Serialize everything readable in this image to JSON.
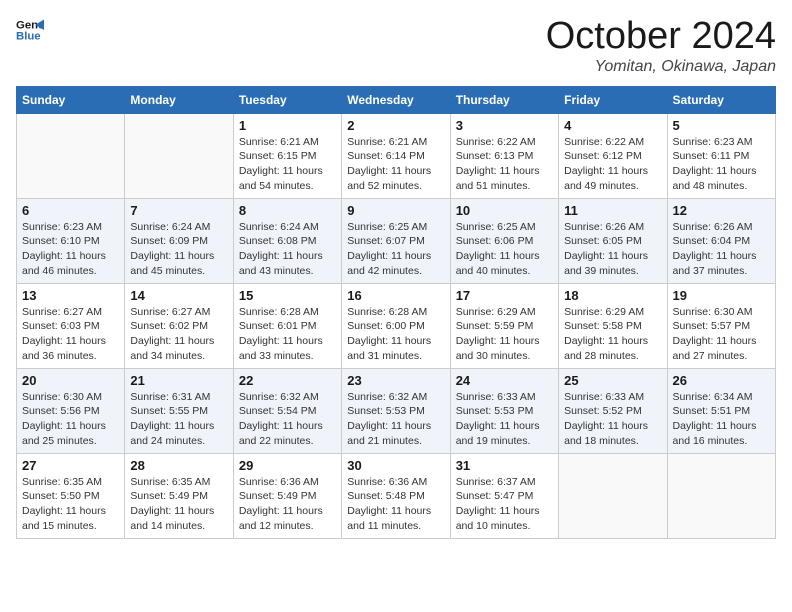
{
  "header": {
    "logo_line1": "General",
    "logo_line2": "Blue",
    "month": "October 2024",
    "location": "Yomitan, Okinawa, Japan"
  },
  "weekdays": [
    "Sunday",
    "Monday",
    "Tuesday",
    "Wednesday",
    "Thursday",
    "Friday",
    "Saturday"
  ],
  "weeks": [
    [
      {
        "day": "",
        "info": ""
      },
      {
        "day": "",
        "info": ""
      },
      {
        "day": "1",
        "info": "Sunrise: 6:21 AM\nSunset: 6:15 PM\nDaylight: 11 hours and 54 minutes."
      },
      {
        "day": "2",
        "info": "Sunrise: 6:21 AM\nSunset: 6:14 PM\nDaylight: 11 hours and 52 minutes."
      },
      {
        "day": "3",
        "info": "Sunrise: 6:22 AM\nSunset: 6:13 PM\nDaylight: 11 hours and 51 minutes."
      },
      {
        "day": "4",
        "info": "Sunrise: 6:22 AM\nSunset: 6:12 PM\nDaylight: 11 hours and 49 minutes."
      },
      {
        "day": "5",
        "info": "Sunrise: 6:23 AM\nSunset: 6:11 PM\nDaylight: 11 hours and 48 minutes."
      }
    ],
    [
      {
        "day": "6",
        "info": "Sunrise: 6:23 AM\nSunset: 6:10 PM\nDaylight: 11 hours and 46 minutes."
      },
      {
        "day": "7",
        "info": "Sunrise: 6:24 AM\nSunset: 6:09 PM\nDaylight: 11 hours and 45 minutes."
      },
      {
        "day": "8",
        "info": "Sunrise: 6:24 AM\nSunset: 6:08 PM\nDaylight: 11 hours and 43 minutes."
      },
      {
        "day": "9",
        "info": "Sunrise: 6:25 AM\nSunset: 6:07 PM\nDaylight: 11 hours and 42 minutes."
      },
      {
        "day": "10",
        "info": "Sunrise: 6:25 AM\nSunset: 6:06 PM\nDaylight: 11 hours and 40 minutes."
      },
      {
        "day": "11",
        "info": "Sunrise: 6:26 AM\nSunset: 6:05 PM\nDaylight: 11 hours and 39 minutes."
      },
      {
        "day": "12",
        "info": "Sunrise: 6:26 AM\nSunset: 6:04 PM\nDaylight: 11 hours and 37 minutes."
      }
    ],
    [
      {
        "day": "13",
        "info": "Sunrise: 6:27 AM\nSunset: 6:03 PM\nDaylight: 11 hours and 36 minutes."
      },
      {
        "day": "14",
        "info": "Sunrise: 6:27 AM\nSunset: 6:02 PM\nDaylight: 11 hours and 34 minutes."
      },
      {
        "day": "15",
        "info": "Sunrise: 6:28 AM\nSunset: 6:01 PM\nDaylight: 11 hours and 33 minutes."
      },
      {
        "day": "16",
        "info": "Sunrise: 6:28 AM\nSunset: 6:00 PM\nDaylight: 11 hours and 31 minutes."
      },
      {
        "day": "17",
        "info": "Sunrise: 6:29 AM\nSunset: 5:59 PM\nDaylight: 11 hours and 30 minutes."
      },
      {
        "day": "18",
        "info": "Sunrise: 6:29 AM\nSunset: 5:58 PM\nDaylight: 11 hours and 28 minutes."
      },
      {
        "day": "19",
        "info": "Sunrise: 6:30 AM\nSunset: 5:57 PM\nDaylight: 11 hours and 27 minutes."
      }
    ],
    [
      {
        "day": "20",
        "info": "Sunrise: 6:30 AM\nSunset: 5:56 PM\nDaylight: 11 hours and 25 minutes."
      },
      {
        "day": "21",
        "info": "Sunrise: 6:31 AM\nSunset: 5:55 PM\nDaylight: 11 hours and 24 minutes."
      },
      {
        "day": "22",
        "info": "Sunrise: 6:32 AM\nSunset: 5:54 PM\nDaylight: 11 hours and 22 minutes."
      },
      {
        "day": "23",
        "info": "Sunrise: 6:32 AM\nSunset: 5:53 PM\nDaylight: 11 hours and 21 minutes."
      },
      {
        "day": "24",
        "info": "Sunrise: 6:33 AM\nSunset: 5:53 PM\nDaylight: 11 hours and 19 minutes."
      },
      {
        "day": "25",
        "info": "Sunrise: 6:33 AM\nSunset: 5:52 PM\nDaylight: 11 hours and 18 minutes."
      },
      {
        "day": "26",
        "info": "Sunrise: 6:34 AM\nSunset: 5:51 PM\nDaylight: 11 hours and 16 minutes."
      }
    ],
    [
      {
        "day": "27",
        "info": "Sunrise: 6:35 AM\nSunset: 5:50 PM\nDaylight: 11 hours and 15 minutes."
      },
      {
        "day": "28",
        "info": "Sunrise: 6:35 AM\nSunset: 5:49 PM\nDaylight: 11 hours and 14 minutes."
      },
      {
        "day": "29",
        "info": "Sunrise: 6:36 AM\nSunset: 5:49 PM\nDaylight: 11 hours and 12 minutes."
      },
      {
        "day": "30",
        "info": "Sunrise: 6:36 AM\nSunset: 5:48 PM\nDaylight: 11 hours and 11 minutes."
      },
      {
        "day": "31",
        "info": "Sunrise: 6:37 AM\nSunset: 5:47 PM\nDaylight: 11 hours and 10 minutes."
      },
      {
        "day": "",
        "info": ""
      },
      {
        "day": "",
        "info": ""
      }
    ]
  ]
}
